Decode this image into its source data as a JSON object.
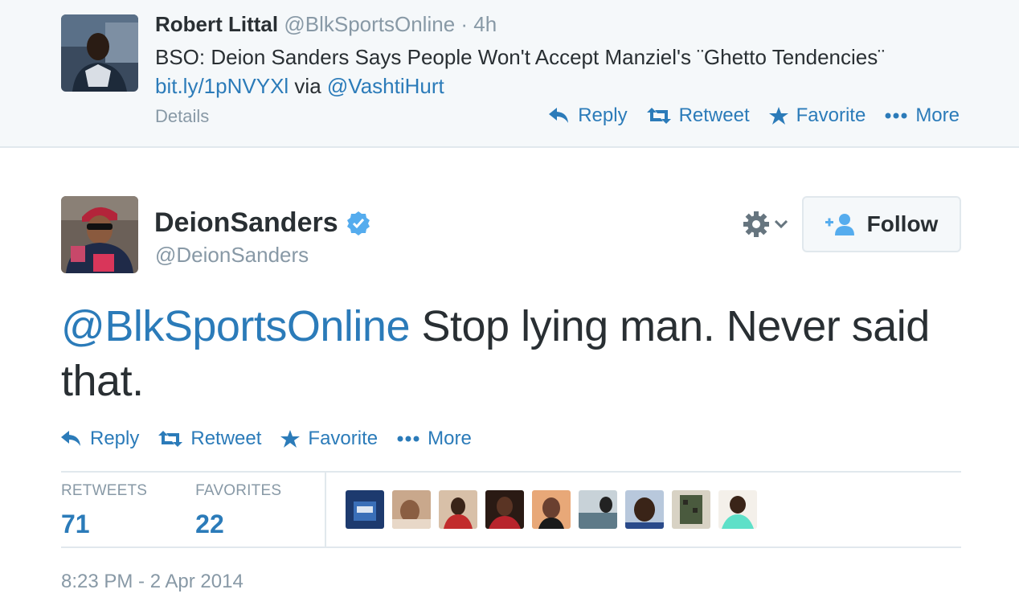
{
  "parent_tweet": {
    "fullname": "Robert Littal",
    "username": "@BlkSportsOnline",
    "separator": "·",
    "time": "4h",
    "text_main": "BSO: Deion Sanders Says People Won't Accept Manziel's ¨Ghetto Tendencies¨",
    "link": "bit.ly/1pNVYXl",
    "via": "via",
    "via_user": "@VashtiHurt",
    "details": "Details",
    "actions": {
      "reply": "Reply",
      "retweet": "Retweet",
      "favorite": "Favorite",
      "more": "More"
    }
  },
  "tweet": {
    "fullname": "DeionSanders",
    "username": "@DeionSanders",
    "verified": true,
    "follow_label": "Follow",
    "mention": "@BlkSportsOnline",
    "text": " Stop lying man. Never said that.",
    "actions": {
      "reply": "Reply",
      "retweet": "Retweet",
      "favorite": "Favorite",
      "more": "More"
    },
    "stats": {
      "retweets_label": "RETWEETS",
      "retweets_count": "71",
      "favorites_label": "FAVORITES",
      "favorites_count": "22"
    },
    "timestamp": "8:23 PM - 2 Apr 2014"
  },
  "colors": {
    "link": "#2b7bb9",
    "muted": "#8899a6",
    "text": "#292f33",
    "verified": "#55acee",
    "parent_bg": "#f5f8fa"
  },
  "icons": [
    "reply-icon",
    "retweet-icon",
    "star-icon",
    "more-dots-icon",
    "gear-icon",
    "chevron-down-icon",
    "verified-badge-icon",
    "add-user-icon"
  ]
}
